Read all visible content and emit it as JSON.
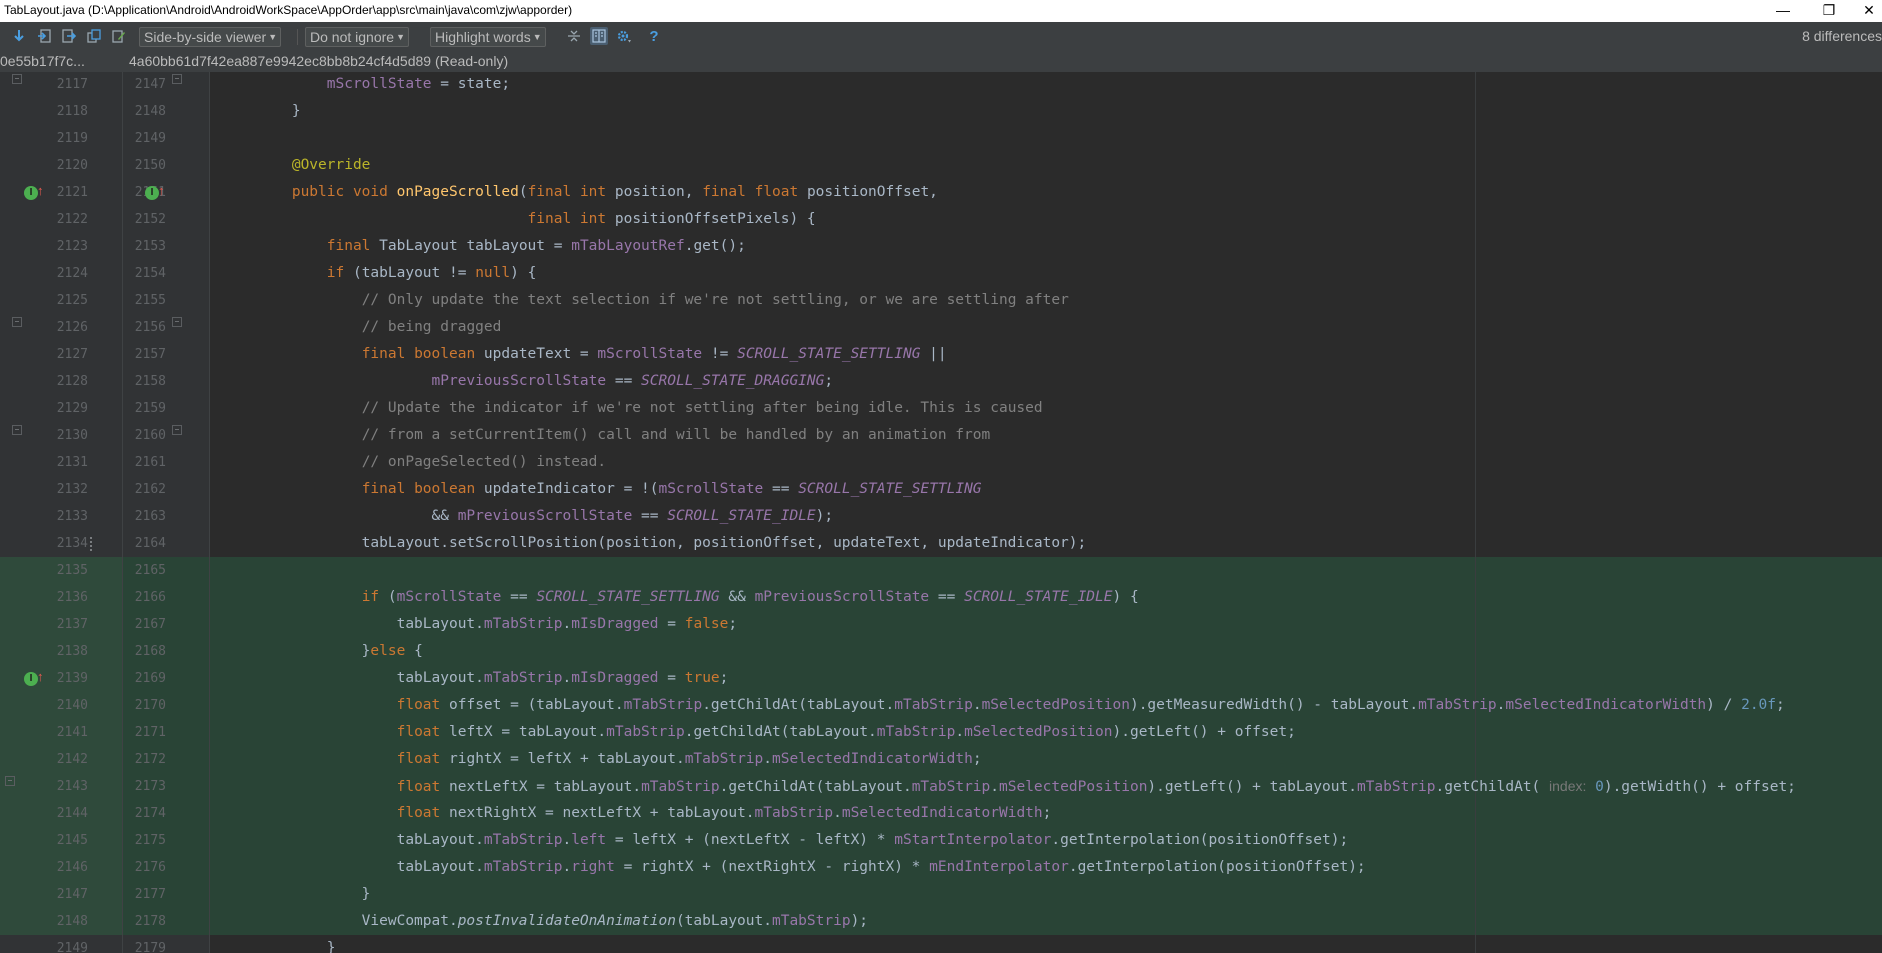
{
  "window": {
    "title": "TabLayout.java (D:\\Application\\Android\\AndroidWorkSpace\\AppOrder\\app\\src\\main\\java\\com\\zjw\\apporder)",
    "minimize": "—",
    "restore": "❐",
    "close": "✕"
  },
  "toolbar": {
    "icons": [
      "next-diff-icon",
      "prev-diff-icon",
      "next-file-icon",
      "compare-icon",
      "edit-icon",
      "collapse-icon",
      "side-by-side-toggle-icon",
      "settings-icon",
      "help-icon"
    ],
    "viewer_select": "Side-by-side viewer",
    "whitespace_select": "Do not ignore",
    "highlight_select": "Highlight words",
    "help_label": "?",
    "diff_count": "8 differences"
  },
  "revisions": {
    "left": "0e55b17f7c...",
    "right": "4a60bb61d7f42ea887e9942ec8bb8b24cf4d5d89 (Read-only)"
  },
  "lines": [
    {
      "left": "2117",
      "right": "2147"
    },
    {
      "left": "2118",
      "right": "2148"
    },
    {
      "left": "2119",
      "right": "2149"
    },
    {
      "left": "2120",
      "right": "2150"
    },
    {
      "left": "2121",
      "right": "2151"
    },
    {
      "left": "2122",
      "right": "2152"
    },
    {
      "left": "2123",
      "right": "2153"
    },
    {
      "left": "2124",
      "right": "2154"
    },
    {
      "left": "2125",
      "right": "2155"
    },
    {
      "left": "2126",
      "right": "2156"
    },
    {
      "left": "2127",
      "right": "2157"
    },
    {
      "left": "2128",
      "right": "2158"
    },
    {
      "left": "2129",
      "right": "2159"
    },
    {
      "left": "2130",
      "right": "2160"
    },
    {
      "left": "2131",
      "right": "2161"
    },
    {
      "left": "2132",
      "right": "2162"
    },
    {
      "left": "2133",
      "right": "2163"
    },
    {
      "left": "2134",
      "right": "2164"
    },
    {
      "left": "2135",
      "right": "2165"
    },
    {
      "left": "2136",
      "right": "2166"
    },
    {
      "left": "2137",
      "right": "2167"
    },
    {
      "left": "2138",
      "right": "2168"
    },
    {
      "left": "2139",
      "right": "2169"
    },
    {
      "left": "2140",
      "right": "2170"
    },
    {
      "left": "2141",
      "right": "2171"
    },
    {
      "left": "2142",
      "right": "2172"
    },
    {
      "left": "2143",
      "right": "2173"
    },
    {
      "left": "2144",
      "right": "2174"
    },
    {
      "left": "2145",
      "right": "2175"
    },
    {
      "left": "2146",
      "right": "2176"
    },
    {
      "left": "2147",
      "right": "2177"
    },
    {
      "left": "2148",
      "right": "2178"
    },
    {
      "left": "2149",
      "right": "2179"
    }
  ],
  "code": [
    [
      [
        "",
        "            "
      ],
      [
        "fld",
        "mScrollState"
      ],
      [
        "",
        " = state;"
      ]
    ],
    [
      [
        "",
        "        }"
      ]
    ],
    [
      [
        "",
        ""
      ]
    ],
    [
      [
        "",
        "        "
      ],
      [
        "ann",
        "@Override"
      ]
    ],
    [
      [
        "",
        "        "
      ],
      [
        "kw",
        "public void "
      ],
      [
        "fn",
        "onPageScrolled"
      ],
      [
        "",
        "("
      ],
      [
        "kw",
        "final int "
      ],
      [
        "",
        "position, "
      ],
      [
        "kw",
        "final float "
      ],
      [
        "",
        "positionOffset,"
      ]
    ],
    [
      [
        "",
        "                                   "
      ],
      [
        "kw",
        "final int "
      ],
      [
        "",
        "positionOffsetPixels) {"
      ]
    ],
    [
      [
        "",
        "            "
      ],
      [
        "kw",
        "final "
      ],
      [
        "",
        "TabLayout tabLayout = "
      ],
      [
        "fld",
        "mTabLayoutRef"
      ],
      [
        "",
        ".get();"
      ]
    ],
    [
      [
        "",
        "            "
      ],
      [
        "kw",
        "if "
      ],
      [
        "",
        "(tabLayout != "
      ],
      [
        "kw",
        "null"
      ],
      [
        "",
        ") {"
      ]
    ],
    [
      [
        "",
        "                "
      ],
      [
        "cm",
        "// Only update the text selection if we're not settling, or we are settling after"
      ]
    ],
    [
      [
        "",
        "                "
      ],
      [
        "cm",
        "// being dragged"
      ]
    ],
    [
      [
        "",
        "                "
      ],
      [
        "kw",
        "final boolean "
      ],
      [
        "",
        "updateText = "
      ],
      [
        "fld",
        "mScrollState"
      ],
      [
        "",
        " != "
      ],
      [
        "cst",
        "SCROLL_STATE_SETTLING"
      ],
      [
        "",
        " ||"
      ]
    ],
    [
      [
        "",
        "                        "
      ],
      [
        "fld",
        "mPreviousScrollState"
      ],
      [
        "",
        " == "
      ],
      [
        "cst",
        "SCROLL_STATE_DRAGGING"
      ],
      [
        "",
        ";"
      ]
    ],
    [
      [
        "",
        "                "
      ],
      [
        "cm",
        "// Update the indicator if we're not settling after being idle. This is caused"
      ]
    ],
    [
      [
        "",
        "                "
      ],
      [
        "cm",
        "// from a setCurrentItem() call and will be handled by an animation from"
      ]
    ],
    [
      [
        "",
        "                "
      ],
      [
        "cm",
        "// onPageSelected() instead."
      ]
    ],
    [
      [
        "",
        "                "
      ],
      [
        "kw",
        "final boolean "
      ],
      [
        "",
        "updateIndicator = !("
      ],
      [
        "fld",
        "mScrollState"
      ],
      [
        "",
        " == "
      ],
      [
        "cst",
        "SCROLL_STATE_SETTLING"
      ]
    ],
    [
      [
        "",
        "                        && "
      ],
      [
        "fld",
        "mPreviousScrollState"
      ],
      [
        "",
        " == "
      ],
      [
        "cst",
        "SCROLL_STATE_IDLE"
      ],
      [
        "",
        ");"
      ]
    ],
    [
      [
        "",
        "                tabLayout.setScrollPosition(position, positionOffset, updateText, updateIndicator);"
      ]
    ],
    [
      [
        "",
        ""
      ]
    ],
    [
      [
        "",
        "                "
      ],
      [
        "kw",
        "if "
      ],
      [
        "",
        "("
      ],
      [
        "fld",
        "mScrollState"
      ],
      [
        "",
        " == "
      ],
      [
        "cst",
        "SCROLL_STATE_SETTLING"
      ],
      [
        "",
        " && "
      ],
      [
        "fld",
        "mPreviousScrollState"
      ],
      [
        "",
        " == "
      ],
      [
        "cst",
        "SCROLL_STATE_IDLE"
      ],
      [
        "",
        ") {"
      ]
    ],
    [
      [
        "",
        "                    tabLayout."
      ],
      [
        "fld",
        "mTabStrip"
      ],
      [
        "",
        "."
      ],
      [
        "fld",
        "mIsDragged"
      ],
      [
        "",
        " = "
      ],
      [
        "kw",
        "false"
      ],
      [
        "",
        ";"
      ]
    ],
    [
      [
        "",
        "                }"
      ],
      [
        "kw",
        "else "
      ],
      [
        "",
        "{"
      ]
    ],
    [
      [
        "",
        "                    tabLayout."
      ],
      [
        "fld",
        "mTabStrip"
      ],
      [
        "",
        "."
      ],
      [
        "fld",
        "mIsDragged"
      ],
      [
        "",
        " = "
      ],
      [
        "kw",
        "true"
      ],
      [
        "",
        ";"
      ]
    ],
    [
      [
        "",
        "                    "
      ],
      [
        "kw",
        "float "
      ],
      [
        "",
        "offset = (tabLayout."
      ],
      [
        "fld",
        "mTabStrip"
      ],
      [
        "",
        ".getChildAt(tabLayout."
      ],
      [
        "fld",
        "mTabStrip"
      ],
      [
        "",
        "."
      ],
      [
        "fld",
        "mSelectedPosition"
      ],
      [
        "",
        ").getMeasuredWidth() - tabLayout."
      ],
      [
        "fld",
        "mTabStrip"
      ],
      [
        "",
        "."
      ],
      [
        "fld",
        "mSelectedIndicatorWidth"
      ],
      [
        "",
        ") / "
      ],
      [
        "num",
        "2.0f"
      ],
      [
        "",
        ";"
      ]
    ],
    [
      [
        "",
        "                    "
      ],
      [
        "kw",
        "float "
      ],
      [
        "",
        "leftX = tabLayout."
      ],
      [
        "fld",
        "mTabStrip"
      ],
      [
        "",
        ".getChildAt(tabLayout."
      ],
      [
        "fld",
        "mTabStrip"
      ],
      [
        "",
        "."
      ],
      [
        "fld",
        "mSelectedPosition"
      ],
      [
        "",
        ").getLeft() + offset;"
      ]
    ],
    [
      [
        "",
        "                    "
      ],
      [
        "kw",
        "float "
      ],
      [
        "",
        "rightX = leftX + tabLayout."
      ],
      [
        "fld",
        "mTabStrip"
      ],
      [
        "",
        "."
      ],
      [
        "fld",
        "mSelectedIndicatorWidth"
      ],
      [
        "",
        ";"
      ]
    ],
    [
      [
        "",
        "                    "
      ],
      [
        "kw",
        "float "
      ],
      [
        "",
        "nextLeftX = tabLayout."
      ],
      [
        "fld",
        "mTabStrip"
      ],
      [
        "",
        ".getChildAt(tabLayout."
      ],
      [
        "fld",
        "mTabStrip"
      ],
      [
        "",
        "."
      ],
      [
        "fld",
        "mSelectedPosition"
      ],
      [
        "",
        ").getLeft() + tabLayout."
      ],
      [
        "fld",
        "mTabStrip"
      ],
      [
        "",
        ".getChildAt( "
      ],
      [
        "hint",
        "index:"
      ],
      [
        "",
        " "
      ],
      [
        "num",
        "0"
      ],
      [
        "",
        ").getWidth() + offset;"
      ]
    ],
    [
      [
        "",
        "                    "
      ],
      [
        "kw",
        "float "
      ],
      [
        "",
        "nextRightX = nextLeftX + tabLayout."
      ],
      [
        "fld",
        "mTabStrip"
      ],
      [
        "",
        "."
      ],
      [
        "fld",
        "mSelectedIndicatorWidth"
      ],
      [
        "",
        ";"
      ]
    ],
    [
      [
        "",
        "                    tabLayout."
      ],
      [
        "fld",
        "mTabStrip"
      ],
      [
        "",
        "."
      ],
      [
        "fld",
        "left"
      ],
      [
        "",
        " = leftX + (nextLeftX - leftX) * "
      ],
      [
        "fld",
        "mStartInterpolator"
      ],
      [
        "",
        ".getInterpolation(positionOffset);"
      ]
    ],
    [
      [
        "",
        "                    tabLayout."
      ],
      [
        "fld",
        "mTabStrip"
      ],
      [
        "",
        "."
      ],
      [
        "fld",
        "right"
      ],
      [
        "",
        " = rightX + (nextRightX - rightX) * "
      ],
      [
        "fld",
        "mEndInterpolator"
      ],
      [
        "",
        ".getInterpolation(positionOffset);"
      ]
    ],
    [
      [
        "",
        "                }"
      ]
    ],
    [
      [
        "",
        "                ViewCompat."
      ],
      [
        "st",
        "postInvalidateOnAnimation"
      ],
      [
        "",
        "(tabLayout."
      ],
      [
        "fld",
        "mTabStrip"
      ],
      [
        "",
        ");"
      ]
    ],
    [
      [
        "",
        "            }"
      ]
    ]
  ]
}
